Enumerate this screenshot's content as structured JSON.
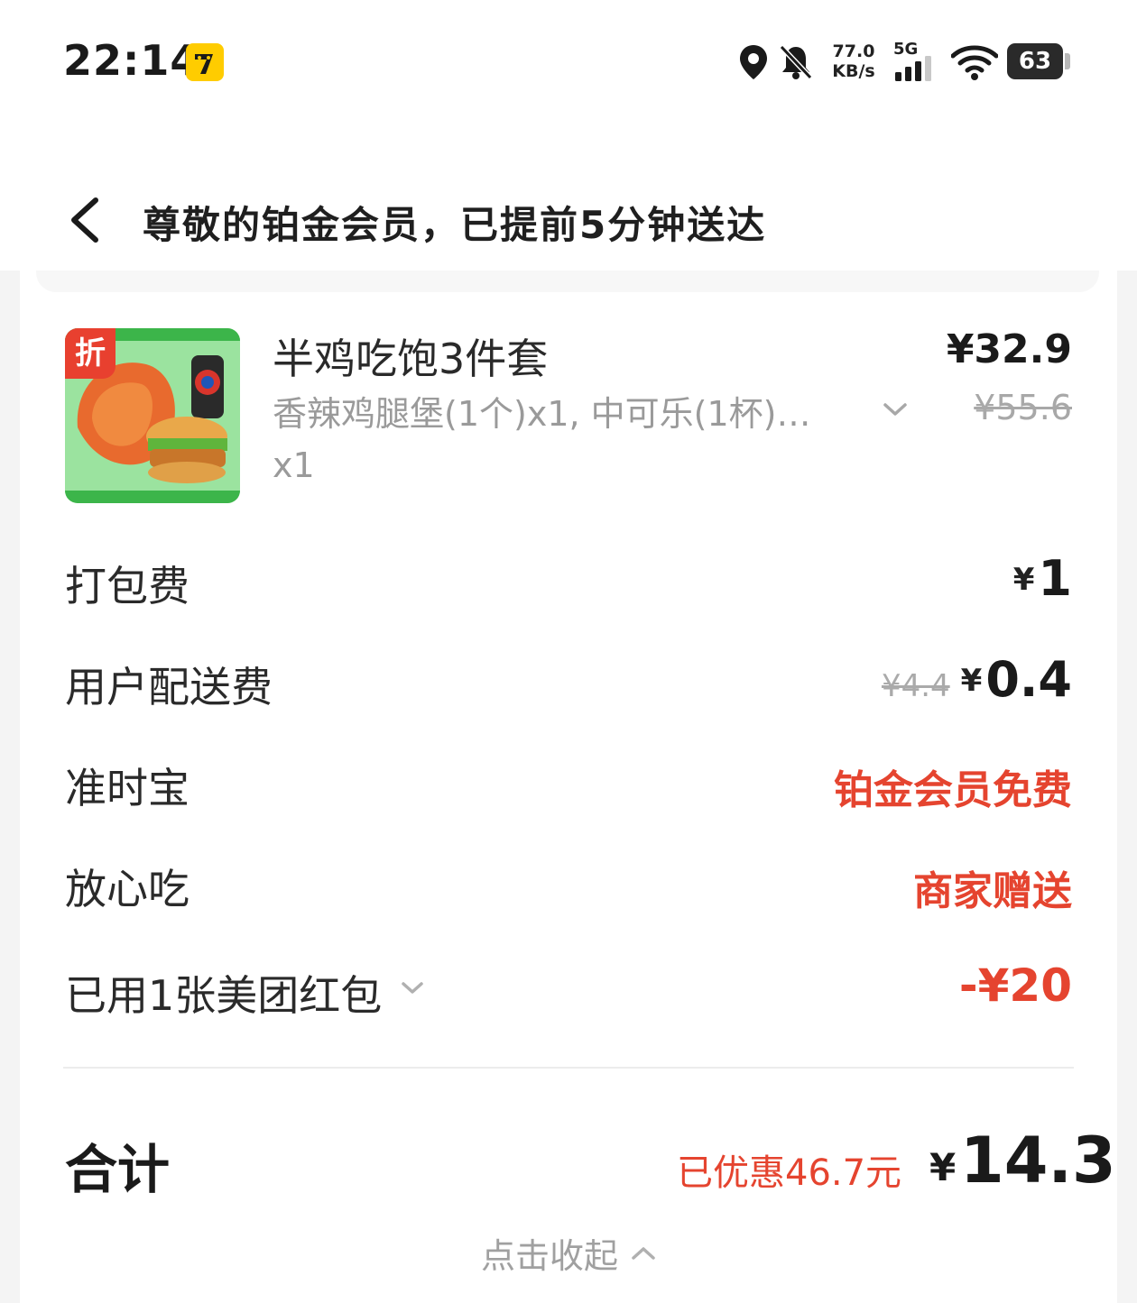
{
  "status_bar": {
    "time": "22:14",
    "net_speed_value": "77.0",
    "net_speed_unit": "KB/s",
    "network_type": "5G",
    "battery": "63"
  },
  "header": {
    "title": "尊敬的铂金会员，已提前5分钟送达"
  },
  "item": {
    "discount_tag": "折",
    "name": "半鸡吃饱3件套",
    "description": "香辣鸡腿堡(1个)x1, 中可乐(1杯)…",
    "quantity": "x1",
    "price": "¥32.9",
    "original_price": "¥55.6"
  },
  "fees": {
    "packing": {
      "label": "打包费",
      "currency": "¥",
      "value": "1"
    },
    "delivery": {
      "label": "用户配送费",
      "original": "¥4.4",
      "currency": "¥",
      "value": "0.4"
    },
    "ontime": {
      "label": "准时宝",
      "value": "铂金会员免费"
    },
    "safe_eat": {
      "label": "放心吃",
      "value": "商家赠送"
    },
    "red_packet": {
      "label": "已用1张美团红包",
      "value": "-¥20"
    }
  },
  "total": {
    "label": "合计",
    "saved": "已优惠46.7元",
    "currency": "¥",
    "value": "14.3"
  },
  "collapse": {
    "label": "点击收起"
  },
  "colors": {
    "accent_red": "#e5442f",
    "badge_yellow": "#ffcc00"
  }
}
